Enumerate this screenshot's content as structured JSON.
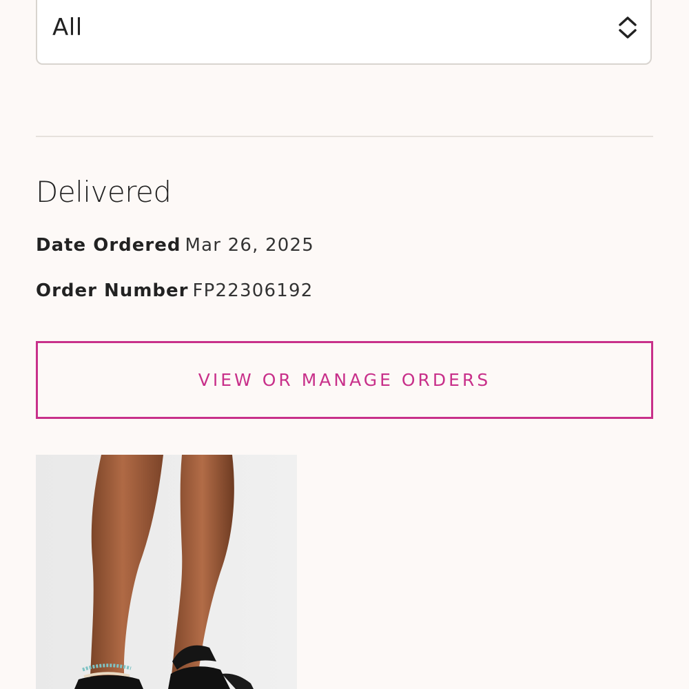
{
  "filter": {
    "selected": "All",
    "icon": "chevron-up-down-icon"
  },
  "order": {
    "status": "Delivered",
    "date_label": "Date Ordered",
    "date_value": "Mar 26, 2025",
    "number_label": "Order Number",
    "number_value": "FP22306192",
    "manage_button_label": "VIEW OR MANAGE ORDERS",
    "product_image": "product-image-black-sandals"
  },
  "colors": {
    "accent": "#c8308a",
    "background": "#fdf9f7",
    "border": "#d8d4cf"
  }
}
